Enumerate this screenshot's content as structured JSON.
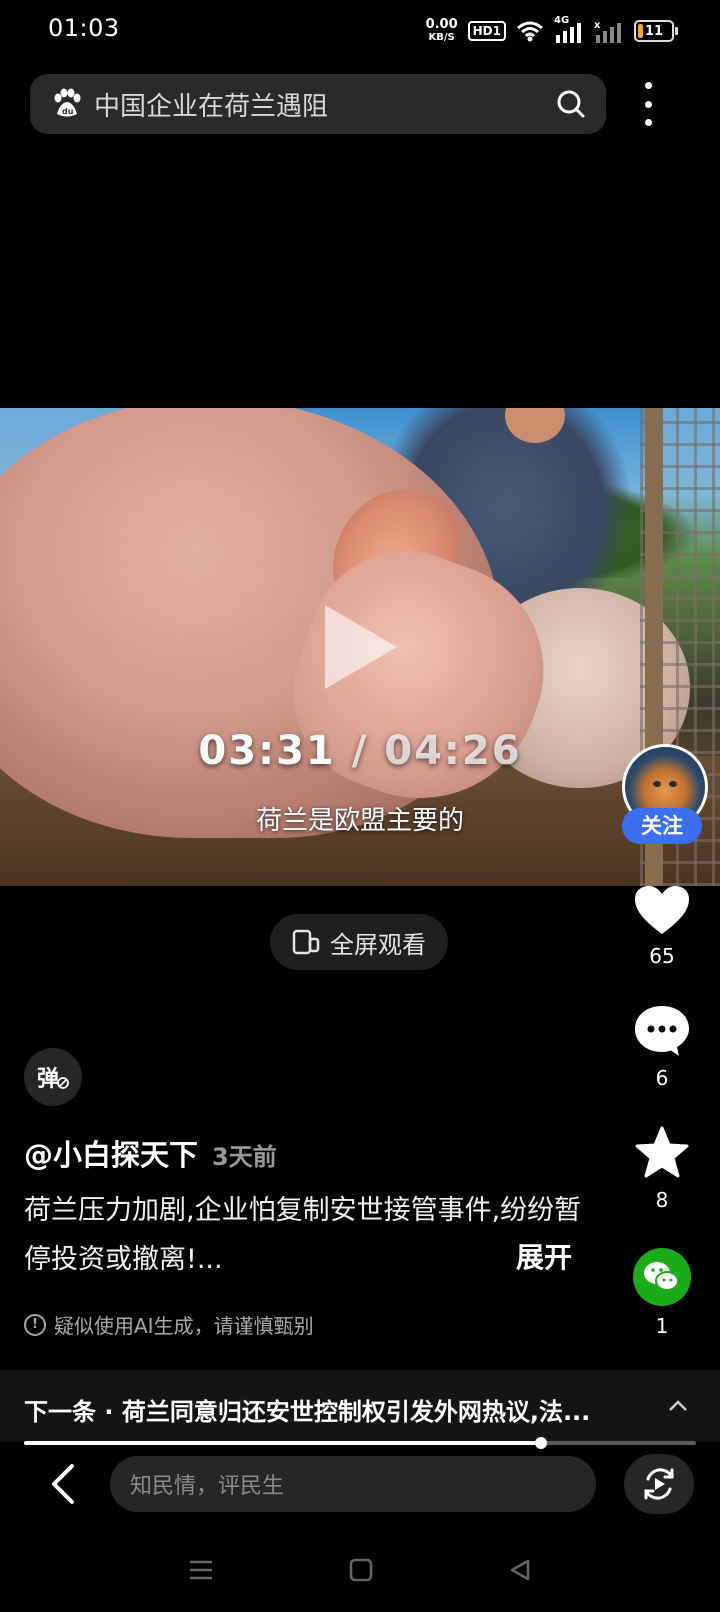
{
  "status_bar": {
    "time": "01:03",
    "net_speed": "0.00",
    "net_unit": "KB/S",
    "hd_label": "HD1",
    "signal_label": "4G",
    "battery": "11"
  },
  "search": {
    "query": "中国企业在荷兰遇阻"
  },
  "video": {
    "current_time": "03:31",
    "separator": "/",
    "total_time": "04:26",
    "caption": "荷兰是欧盟主要的",
    "progress": 0.77
  },
  "fullscreen_label": "全屏观看",
  "danmu_label": "弹",
  "author": {
    "name": "@小白探天下",
    "posted": "3天前",
    "follow_label": "关注"
  },
  "description": "荷兰压力加剧,企业怕复制安世接管事件,纷纷暂停投资或撤离!...",
  "expand_label": "展开",
  "ai_notice": "疑似使用AI生成，请谨慎甄别",
  "actions": {
    "likes": "65",
    "comments": "6",
    "favorites": "8",
    "shares": "1"
  },
  "next": {
    "text": "下一条 · 荷兰同意归还安世控制权引发外网热议,法..."
  },
  "comment_input": {
    "placeholder": "知民情，评民生"
  },
  "colors": {
    "follow_button": "#3b6ff0",
    "wechat_green": "#1aad19"
  }
}
